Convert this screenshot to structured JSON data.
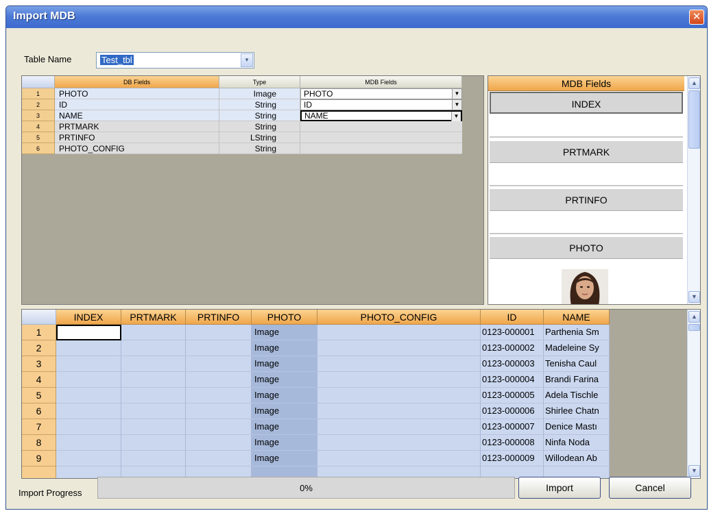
{
  "window": {
    "title": "Import MDB",
    "close_glyph": "✕"
  },
  "table_name": {
    "label": "Table Name",
    "value": "Test_tbl"
  },
  "field_map": {
    "headers": [
      "DB Fields",
      "Type",
      "MDB Fields"
    ],
    "rows": [
      {
        "num": "1",
        "field": "PHOTO",
        "type": "Image",
        "mdb": "PHOTO"
      },
      {
        "num": "2",
        "field": "ID",
        "type": "String",
        "mdb": "ID"
      },
      {
        "num": "3",
        "field": "NAME",
        "type": "String",
        "mdb": "NAME"
      },
      {
        "num": "4",
        "field": "PRTMARK",
        "type": "String",
        "mdb": ""
      },
      {
        "num": "5",
        "field": "PRTINFO",
        "type": "LString",
        "mdb": ""
      },
      {
        "num": "6",
        "field": "PHOTO_CONFIG",
        "type": "String",
        "mdb": ""
      }
    ]
  },
  "mdb_panel": {
    "header": "MDB Fields",
    "fields": [
      "INDEX",
      "PRTMARK",
      "PRTINFO",
      "PHOTO"
    ]
  },
  "data_grid": {
    "headers": [
      "INDEX",
      "PRTMARK",
      "PRTINFO",
      "PHOTO",
      "PHOTO_CONFIG",
      "ID",
      "NAME"
    ],
    "rows": [
      {
        "num": "1",
        "photo": "Image",
        "id": "0123-000001",
        "name": "Parthenia Sm"
      },
      {
        "num": "2",
        "photo": "Image",
        "id": "0123-000002",
        "name": "Madeleine Sy"
      },
      {
        "num": "3",
        "photo": "Image",
        "id": "0123-000003",
        "name": "Tenisha Caul"
      },
      {
        "num": "4",
        "photo": "Image",
        "id": "0123-000004",
        "name": "Brandi Farina"
      },
      {
        "num": "5",
        "photo": "Image",
        "id": "0123-000005",
        "name": "Adela Tischle"
      },
      {
        "num": "6",
        "photo": "Image",
        "id": "0123-000006",
        "name": "Shirlee Chatn"
      },
      {
        "num": "7",
        "photo": "Image",
        "id": "0123-000007",
        "name": "Denice Mastı"
      },
      {
        "num": "8",
        "photo": "Image",
        "id": "0123-000008",
        "name": "Ninfa Noda"
      },
      {
        "num": "9",
        "photo": "Image",
        "id": "0123-000009",
        "name": "Willodean Ab"
      }
    ]
  },
  "progress": {
    "label": "Import Progress",
    "text": "0%",
    "value": 0
  },
  "buttons": {
    "import": "Import",
    "cancel": "Cancel"
  },
  "colors": {
    "header_orange": "#f0a64a",
    "row_blue": "#cad7ef",
    "title_blue": "#3d6bce"
  },
  "icons": {
    "dropdown": "chevron-down-icon",
    "scroll_up": "arrow-up-icon",
    "scroll_down": "arrow-down-icon",
    "close": "close-icon"
  }
}
